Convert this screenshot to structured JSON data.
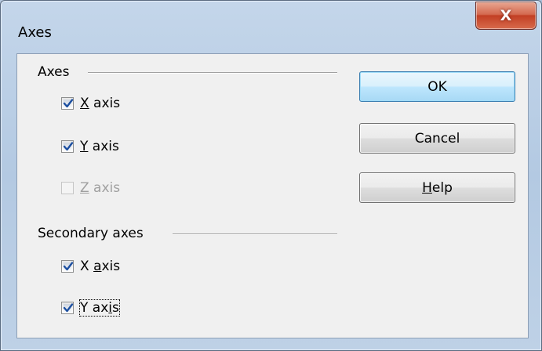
{
  "window": {
    "title": "Axes",
    "close_glyph": "X"
  },
  "axes_group": {
    "label": "Axes",
    "items": [
      {
        "mnemonic": "X",
        "rest": " axis",
        "checked": true,
        "enabled": true
      },
      {
        "mnemonic": "Y",
        "rest": " axis",
        "checked": true,
        "enabled": true
      },
      {
        "mnemonic": "Z",
        "rest": " axis",
        "checked": false,
        "enabled": false
      }
    ]
  },
  "secondary_group": {
    "label": "Secondary axes",
    "items": [
      {
        "pre": "X ",
        "mnemonic": "a",
        "rest": "xis",
        "checked": true,
        "enabled": true
      },
      {
        "pre": "Y ax",
        "mnemonic": "i",
        "rest": "s",
        "checked": true,
        "enabled": true,
        "focused": true
      }
    ]
  },
  "buttons": {
    "ok": "OK",
    "cancel": "Cancel",
    "help_mnemonic": "H",
    "help_rest": "elp"
  },
  "colors": {
    "check": "#1c4fa0",
    "default_button_border": "#3c7fb1",
    "close_button": "#c23f24"
  }
}
